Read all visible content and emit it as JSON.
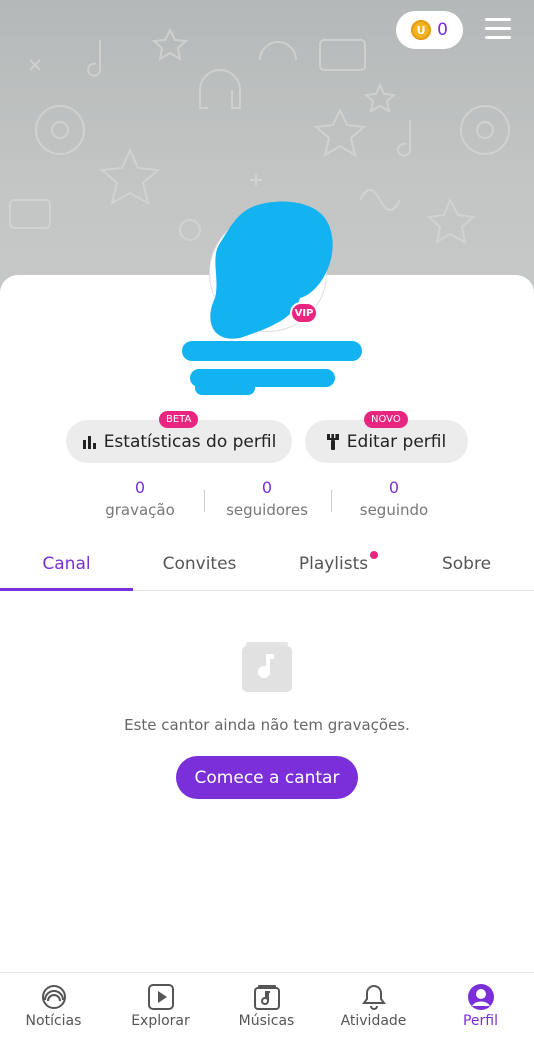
{
  "header": {
    "coin_count": "0",
    "coin_icon": "coin-icon",
    "menu_icon": "hamburger-menu-icon"
  },
  "profile": {
    "vip_badge": "VIP"
  },
  "actions": {
    "stats_label": "Estatísticas do perfil",
    "stats_badge": "BETA",
    "edit_label": "Editar perfil",
    "edit_badge": "NOVO"
  },
  "stats": [
    {
      "value": "0",
      "label": "gravação"
    },
    {
      "value": "0",
      "label": "seguidores"
    },
    {
      "value": "0",
      "label": "seguindo"
    }
  ],
  "tabs": [
    {
      "label": "Canal",
      "active": true
    },
    {
      "label": "Convites"
    },
    {
      "label": "Playlists",
      "has_dot": true
    },
    {
      "label": "Sobre"
    }
  ],
  "empty_state": {
    "icon": "music-folder-icon",
    "text": "Este cantor ainda não tem gravações.",
    "cta": "Comece a cantar"
  },
  "bottom_nav": [
    {
      "label": "Notícias",
      "icon": "news-icon"
    },
    {
      "label": "Explorar",
      "icon": "play-icon"
    },
    {
      "label": "Músicas",
      "icon": "music-note-icon"
    },
    {
      "label": "Atividade",
      "icon": "bell-icon"
    },
    {
      "label": "Perfil",
      "icon": "profile-icon",
      "active": true
    }
  ],
  "colors": {
    "accent": "#7a2fd9",
    "badge": "#e8257f",
    "redaction": "#12b3f0"
  }
}
